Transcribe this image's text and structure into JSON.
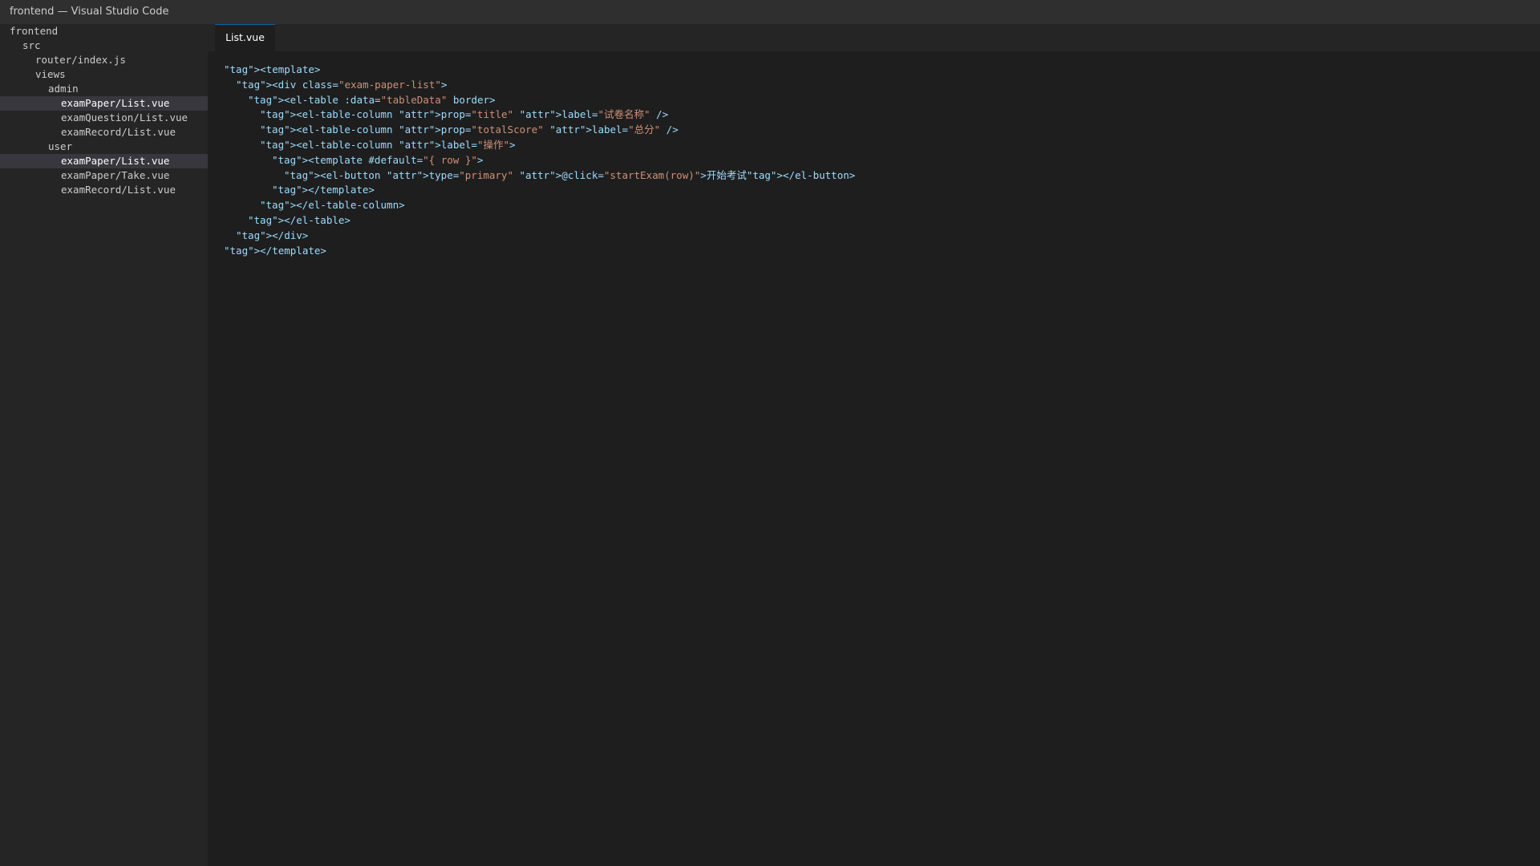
{
  "window": {
    "title": "frontend — Visual Studio Code"
  },
  "explorer": {
    "items": [
      {
        "label": "frontend",
        "depth": 0,
        "selected": false
      },
      {
        "label": "src",
        "depth": 1,
        "selected": false
      },
      {
        "label": "router/index.js",
        "depth": 2,
        "selected": false
      },
      {
        "label": "views",
        "depth": 2,
        "selected": false
      },
      {
        "label": "admin",
        "depth": 3,
        "selected": false
      },
      {
        "label": "examPaper/List.vue",
        "depth": 4,
        "selected": true
      },
      {
        "label": "examQuestion/List.vue",
        "depth": 4,
        "selected": false
      },
      {
        "label": "examRecord/List.vue",
        "depth": 4,
        "selected": false
      },
      {
        "label": "user",
        "depth": 3,
        "selected": false
      },
      {
        "label": "examPaper/List.vue",
        "depth": 4,
        "selected": true
      },
      {
        "label": "examPaper/Take.vue",
        "depth": 4,
        "selected": false
      },
      {
        "label": "examRecord/List.vue",
        "depth": 4,
        "selected": false
      }
    ]
  },
  "editor": {
    "tab": {
      "label": "List.vue"
    },
    "lines": [
      {
        "indent": 0,
        "parts": [
          {
            "t": "\"tag\"><template>",
            "c": "tag"
          }
        ]
      },
      {
        "indent": 1,
        "parts": [
          {
            "t": "\"tag\"><div class=",
            "c": "tag"
          },
          {
            "t": "\"exam-paper-list\"",
            "c": "str"
          },
          {
            "t": ">",
            "c": "tag"
          }
        ]
      },
      {
        "indent": 2,
        "parts": [
          {
            "t": "\"tag\"><el-table :data=",
            "c": "tag"
          },
          {
            "t": "\"tableData\"",
            "c": "str"
          },
          {
            "t": " border>",
            "c": "tag"
          }
        ]
      },
      {
        "indent": 3,
        "parts": [
          {
            "t": "\"tag\"><el-table-column \"attr\">prop=",
            "c": "tag"
          },
          {
            "t": "\"title\"",
            "c": "str"
          },
          {
            "t": " \"attr\">label=",
            "c": "tag"
          },
          {
            "t": "\"试卷名称\"",
            "c": "str"
          },
          {
            "t": " />",
            "c": "tag"
          }
        ]
      },
      {
        "indent": 3,
        "parts": [
          {
            "t": "\"tag\"><el-table-column \"attr\">prop=",
            "c": "tag"
          },
          {
            "t": "\"totalScore\"",
            "c": "str"
          },
          {
            "t": " \"attr\">label=",
            "c": "tag"
          },
          {
            "t": "\"总分\"",
            "c": "str"
          },
          {
            "t": " />",
            "c": "tag"
          }
        ]
      },
      {
        "indent": 3,
        "parts": [
          {
            "t": "\"tag\"><el-table-column \"attr\">label=",
            "c": "tag"
          },
          {
            "t": "\"操作\"",
            "c": "str"
          },
          {
            "t": ">",
            "c": "tag"
          }
        ]
      },
      {
        "indent": 4,
        "parts": [
          {
            "t": "\"tag\"><template #default=",
            "c": "tag"
          },
          {
            "t": "\"{ row }\"",
            "c": "str"
          },
          {
            "t": ">",
            "c": "tag"
          }
        ]
      },
      {
        "indent": 5,
        "parts": [
          {
            "t": "\"tag\"><el-button \"attr\">type=",
            "c": "tag"
          },
          {
            "t": "\"primary\"",
            "c": "str"
          },
          {
            "t": " \"attr\">@click=",
            "c": "tag"
          },
          {
            "t": "\"startExam(row)\"",
            "c": "str"
          },
          {
            "t": ">开始考试\"tag\"></el-button>",
            "c": "tag"
          }
        ]
      },
      {
        "indent": 4,
        "parts": [
          {
            "t": "\"tag\"></template>",
            "c": "tag"
          }
        ]
      },
      {
        "indent": 3,
        "parts": [
          {
            "t": "\"tag\"></el-table-column>",
            "c": "tag"
          }
        ]
      },
      {
        "indent": 2,
        "parts": [
          {
            "t": "\"tag\"></el-table>",
            "c": "tag"
          }
        ]
      },
      {
        "indent": 1,
        "parts": [
          {
            "t": "\"tag\"></div>",
            "c": "tag"
          }
        ]
      },
      {
        "indent": 0,
        "parts": [
          {
            "t": "\"tag\"></template>",
            "c": "tag"
          }
        ]
      }
    ]
  },
  "colors": {
    "tag": "#9cdcfe",
    "string": "#ce9178",
    "selection": "#37373d",
    "tab_accent": "#0e639c"
  }
}
